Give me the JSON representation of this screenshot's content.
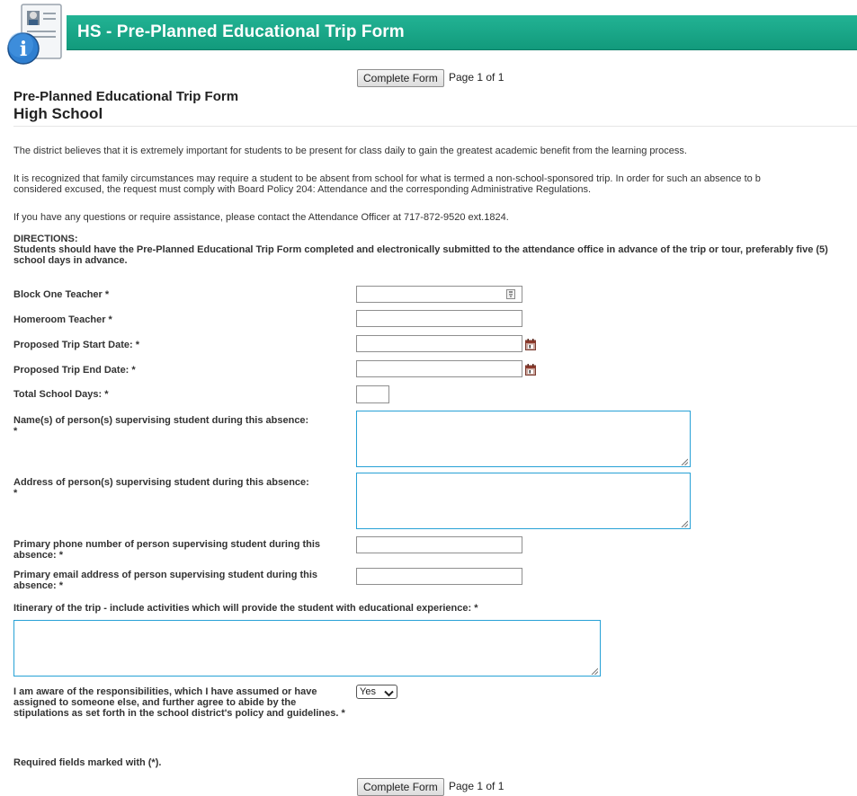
{
  "header": {
    "title": "HS - Pre-Planned Educational Trip Form"
  },
  "toolbar": {
    "complete_label": "Complete Form",
    "page_label": "Page 1 of 1"
  },
  "form": {
    "title_line1": "Pre-Planned Educational Trip Form",
    "title_line2": "High School",
    "para1": "The district believes that it is extremely important for students to be present for class daily to gain the greatest academic benefit from the learning process.",
    "para2_line1": "It is recognized that family circumstances may require a student to be absent from school for what is termed a non-school-sponsored trip. In order for such an absence to b",
    "para2_line2": "considered excused, the request must comply with Board Policy 204: Attendance and the corresponding Administrative Regulations.",
    "para3": "If you have any questions or require assistance, please contact the Attendance Officer at 717-872-9520 ext.1824.",
    "directions_title": "DIRECTIONS:",
    "directions_text": "Students should have the Pre-Planned Educational Trip Form completed and electronically submitted to the attendance office in advance of the trip or tour, preferably five (5) school days in advance.",
    "fields": {
      "block_one_teacher": "Block One Teacher *",
      "homeroom_teacher": "Homeroom Teacher *",
      "start_date": "Proposed Trip Start Date: *",
      "end_date": "Proposed Trip End Date: *",
      "total_days": "Total School Days: *",
      "supervisor_names": "Name(s) of person(s) supervising student during this absence:",
      "supervisor_address": "Address of person(s) supervising student during this absence:",
      "required_star": "*",
      "primary_phone": "Primary phone number of person supervising student during this absence: *",
      "primary_email": "Primary email address of person supervising student during this absence: *",
      "itinerary": "Itinerary of the trip - include activities which will provide the student with educational experience: *",
      "agreement": "I am aware of the responsibilities, which I have assumed or have assigned to someone else, and further agree to abide by the stipulations as set forth in the school district's policy and guidelines. *"
    },
    "agreement_value": "Yes",
    "required_note": "Required fields marked with (*)."
  },
  "colors": {
    "header": "#19a888",
    "textarea_border": "#27a1d6"
  },
  "icons": [
    "info-form-icon",
    "lookup-icon",
    "calendar-icon"
  ]
}
